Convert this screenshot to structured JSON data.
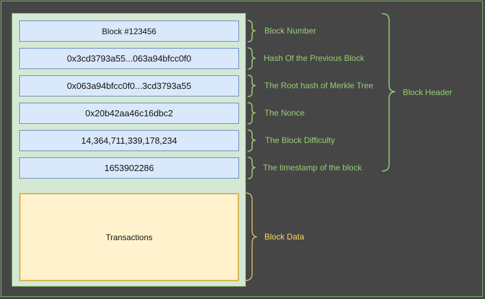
{
  "block": {
    "fields": [
      {
        "value": "Block #123456",
        "label": "Block Number"
      },
      {
        "value": "0x3cd3793a55...063a94bfcc0f0",
        "label": "Hash Of the Previous Block"
      },
      {
        "value": "0x063a94bfcc0f0...3cd3793a55",
        "label": "The Root hash of Merkle Tree"
      },
      {
        "value": "0x20b42aa46c16dbc2",
        "label": "The Nonce"
      },
      {
        "value": "14,364,711,339,178,234",
        "label": "The Block Difficulty"
      },
      {
        "value": "1653902286",
        "label": "The timestamp of the block"
      }
    ],
    "transactions": "Transactions",
    "data_label": "Block Data",
    "header_label": "Block Header"
  },
  "colors": {
    "background": "#464646",
    "field_fill": "#dae8fc",
    "block_fill": "#d5e8d4",
    "data_fill": "#fff2cc",
    "green_label": "#97d077",
    "yellow_label": "#ffd966"
  }
}
